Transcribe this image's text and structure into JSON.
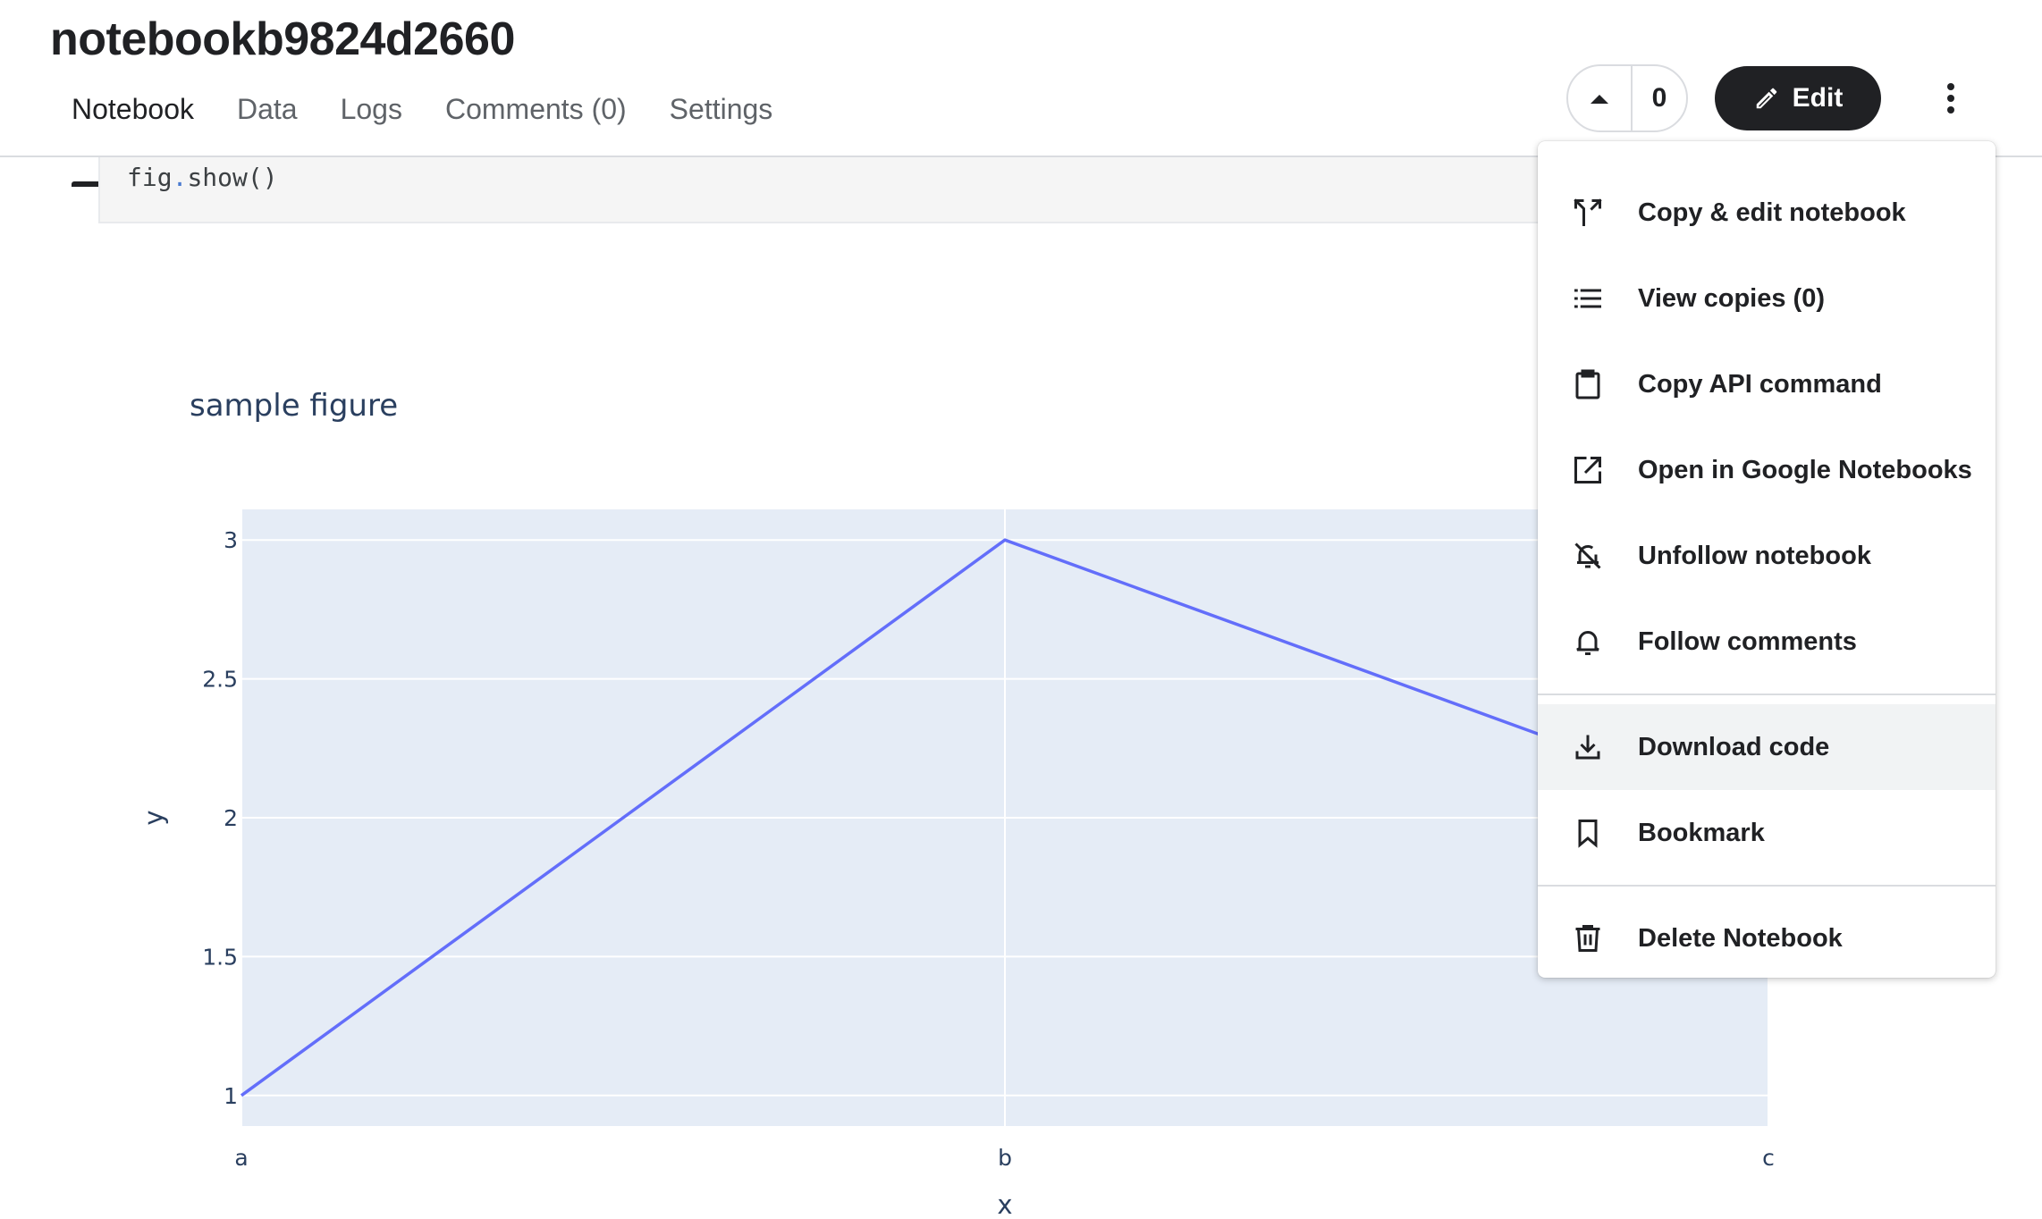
{
  "notebook": {
    "title": "notebookb9824d2660"
  },
  "tabs": [
    {
      "label": "Notebook",
      "active": true
    },
    {
      "label": "Data"
    },
    {
      "label": "Logs"
    },
    {
      "label": "Comments (0)"
    },
    {
      "label": "Settings"
    }
  ],
  "header": {
    "vote_count": "0",
    "edit_label": "Edit",
    "icons": {
      "upvote": "caret-up-icon",
      "edit": "pencil-icon",
      "more": "more-vert-icon"
    }
  },
  "code": {
    "object": "fig",
    "dot": ".",
    "call": "show()"
  },
  "menu": {
    "items": [
      {
        "label": "Copy & edit notebook",
        "icon": "fork-icon"
      },
      {
        "label": "View copies (0)",
        "icon": "list-icon"
      },
      {
        "label": "Copy API command",
        "icon": "clipboard-icon"
      },
      {
        "label": "Open in Google Notebooks",
        "icon": "open-in-new-icon"
      },
      {
        "label": "Unfollow notebook",
        "icon": "notifications-off-icon"
      },
      {
        "label": "Follow comments",
        "icon": "notifications-icon"
      },
      {
        "label": "Download code",
        "icon": "download-icon",
        "hover": true
      },
      {
        "label": "Bookmark",
        "icon": "bookmark-icon"
      },
      {
        "label": "Delete Notebook",
        "icon": "delete-icon"
      }
    ]
  },
  "chart_data": {
    "type": "line",
    "title": "sample figure",
    "xlabel": "x",
    "ylabel": "y",
    "categories": [
      "a",
      "b",
      "c"
    ],
    "values": [
      1,
      3,
      2
    ],
    "ylim": [
      0.89,
      3.11
    ],
    "yticks": [
      1,
      1.5,
      2,
      2.5,
      3
    ],
    "ytick_labels": [
      "1",
      "1.5",
      "2",
      "2.5",
      "3"
    ],
    "grid": true,
    "colors": {
      "line": "#636efa",
      "plot_bg": "#e5ecf6",
      "grid": "#ffffff",
      "text": "#2a3f5f"
    }
  }
}
